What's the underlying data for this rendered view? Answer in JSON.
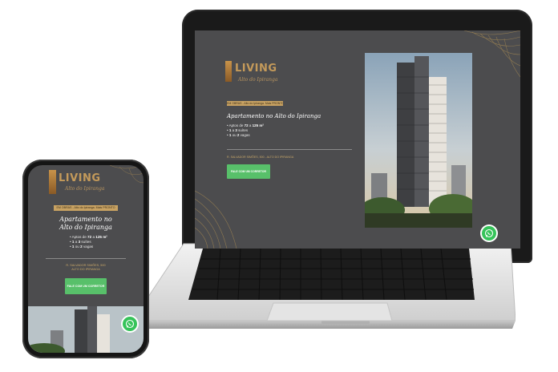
{
  "brand": {
    "name": "LIVING",
    "script": "Alto do Ipiranga",
    "accent": "#c49a5a"
  },
  "launch_tag": "EM OBRAS - Alto do Ipiranga. Mais PRONTO",
  "headline": "Apartamento no Alto do Ipiranga",
  "headline_mobile": [
    "Apartamento no",
    "Alto do Ipiranga"
  ],
  "bullets": [
    {
      "prefix": "• Aptos de ",
      "value": "72",
      "mid": " a ",
      "value2": "125 m²"
    },
    {
      "prefix": "• ",
      "value": "1",
      "mid": " a ",
      "value2": "3",
      "suffix": " suítes"
    },
    {
      "prefix": "• ",
      "value": "1",
      "mid": " ou ",
      "value2": "2",
      "suffix": " vagas"
    }
  ],
  "address": "R. SALVADOR SIMÕES, 500 - ALTO DO IPIRANGA",
  "address_mobile": [
    "R. SALVADOR SIMÕES, 500",
    "ALTO DO IPIRANGA"
  ],
  "cta_label": "FALE COM UM CORRETOR",
  "whatsapp_icon": "whatsapp-icon",
  "colors": {
    "page_bg": "#4c4c4e",
    "cta": "#58c06a",
    "whatsapp": "#36c35a"
  }
}
